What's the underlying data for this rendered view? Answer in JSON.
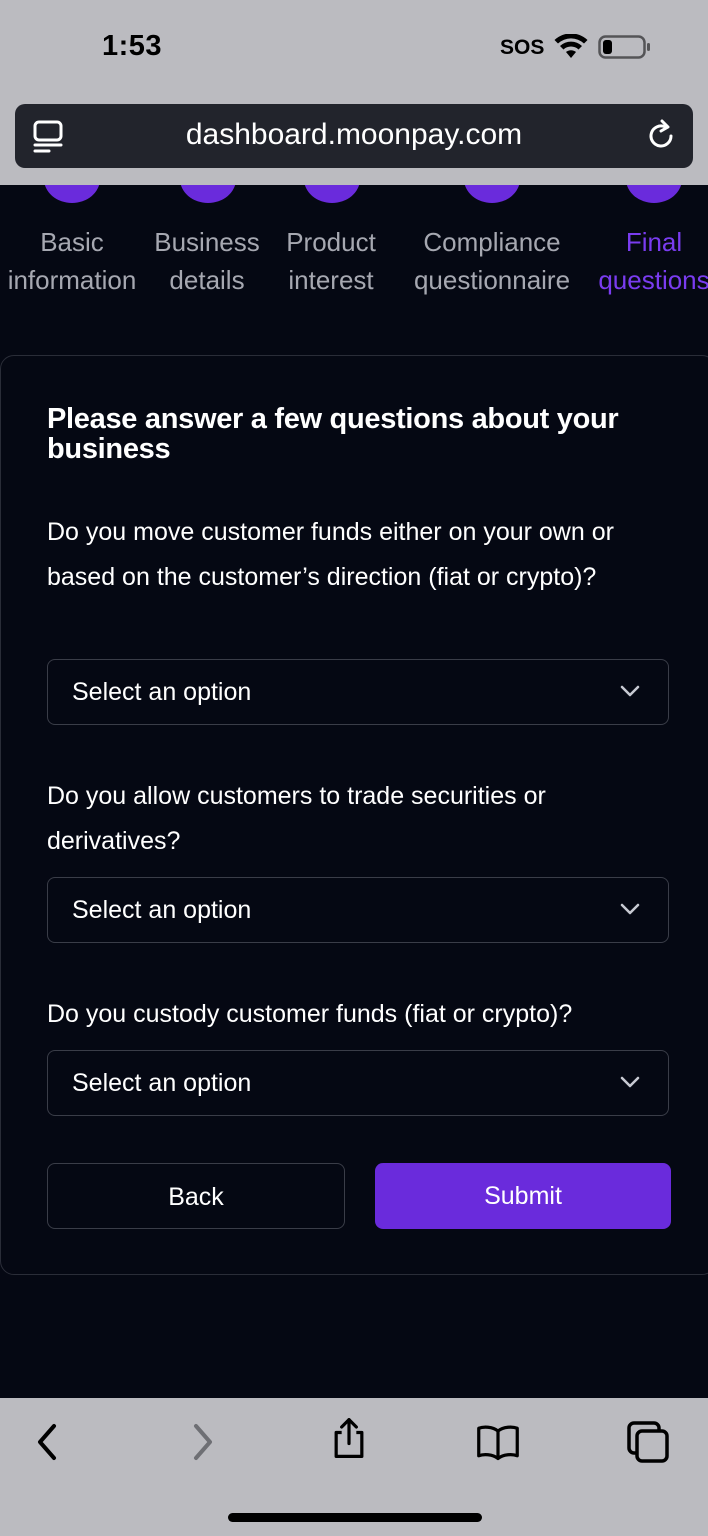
{
  "status_bar": {
    "time": "1:53",
    "sos": "SOS"
  },
  "browser": {
    "url": "dashboard.moonpay.com"
  },
  "steps": [
    {
      "line1": "Basic",
      "line2": "information",
      "active": false
    },
    {
      "line1": "Business",
      "line2": "details",
      "active": false
    },
    {
      "line1": "Product",
      "line2": "interest",
      "active": false
    },
    {
      "line1": "Compliance",
      "line2": "questionnaire",
      "active": false
    },
    {
      "line1": "Final",
      "line2": "questions",
      "active": true
    }
  ],
  "form": {
    "title": "Please answer a few questions about your business",
    "questions": [
      {
        "text": "Do you move customer funds either on your own or based on the customer’s direction (fiat or crypto)?",
        "selected": "Select an option"
      },
      {
        "text": "Do you allow customers to trade securities or derivatives?",
        "selected": "Select an option"
      },
      {
        "text": "Do you custody customer funds (fiat or crypto)?",
        "selected": "Select an option"
      }
    ],
    "back_label": "Back",
    "submit_label": "Submit"
  },
  "colors": {
    "accent": "#6a2bdc",
    "background": "#050813",
    "chrome": "#bbbbc0"
  },
  "toolbar_icons": [
    "back-icon",
    "forward-icon",
    "share-icon",
    "bookmarks-icon",
    "tabs-icon"
  ]
}
